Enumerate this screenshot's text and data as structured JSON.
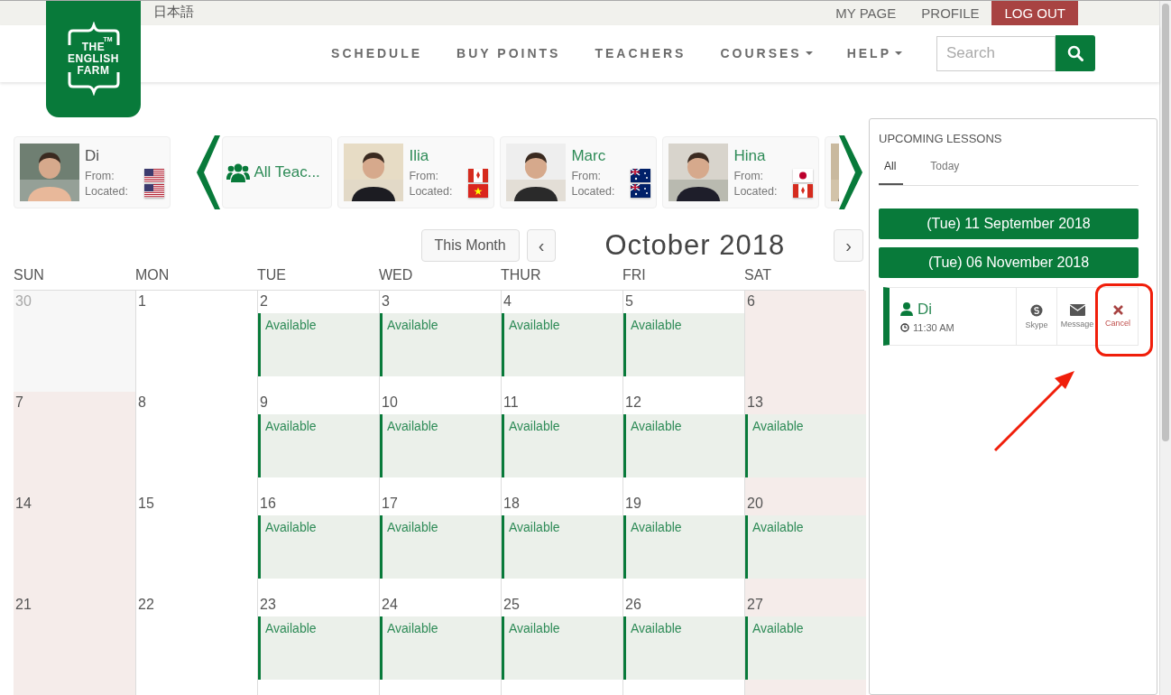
{
  "top_bar": {
    "language": "日本語",
    "links": [
      {
        "label": "MY PAGE",
        "kind": "link"
      },
      {
        "label": "PROFILE",
        "kind": "link"
      },
      {
        "label": "LOG OUT",
        "kind": "danger"
      }
    ]
  },
  "logo": {
    "lines": [
      "THE",
      "ENGLISH",
      "FARM"
    ],
    "mark": "TM"
  },
  "nav": [
    {
      "label": "SCHEDULE",
      "dropdown": false
    },
    {
      "label": "BUY POINTS",
      "dropdown": false
    },
    {
      "label": "TEACHERS",
      "dropdown": false
    },
    {
      "label": "COURSES",
      "dropdown": true
    },
    {
      "label": "HELP",
      "dropdown": true
    }
  ],
  "search": {
    "placeholder": "Search"
  },
  "current_teacher": {
    "name": "Di",
    "photo": {
      "kind": "picture"
    },
    "from": {
      "label": "From:",
      "kind": "us"
    },
    "located": {
      "label": "Located:",
      "kind": "us"
    }
  },
  "carousel": {
    "all_label": "All Teac...",
    "teachers": [
      {
        "name": "Ilia",
        "photo": {
          "kind": "picture"
        },
        "from": {
          "label": "From:",
          "kind": "ca"
        },
        "located": {
          "label": "Located:",
          "kind": "vn"
        }
      },
      {
        "name": "Marc",
        "photo": {
          "kind": "picture"
        },
        "from": {
          "label": "From:",
          "kind": "au"
        },
        "located": {
          "label": "Located:",
          "kind": "au"
        }
      },
      {
        "name": "Hina",
        "photo": {
          "kind": "picture"
        },
        "from": {
          "label": "From:",
          "kind": "jp"
        },
        "located": {
          "label": "Located:",
          "kind": "ca"
        }
      },
      {
        "photo": {
          "kind": "picture"
        }
      }
    ]
  },
  "calendar": {
    "this_month": "This Month",
    "prev": "‹",
    "next": "›",
    "title": "October 2018",
    "weekdays": [
      "SUN",
      "MON",
      "TUE",
      "WED",
      "THUR",
      "FRI",
      "SAT"
    ],
    "weeks": [
      [
        {
          "day": "30",
          "kind": "other"
        },
        {
          "day": "1",
          "kind": "weekday"
        },
        {
          "day": "2",
          "kind": "weekday",
          "slot": "Available"
        },
        {
          "day": "3",
          "kind": "weekday",
          "slot": "Available"
        },
        {
          "day": "4",
          "kind": "weekday",
          "slot": "Available"
        },
        {
          "day": "5",
          "kind": "weekday",
          "slot": "Available"
        },
        {
          "day": "6",
          "kind": "weekend"
        }
      ],
      [
        {
          "day": "7",
          "kind": "weekend"
        },
        {
          "day": "8",
          "kind": "weekday"
        },
        {
          "day": "9",
          "kind": "weekday",
          "slot": "Available"
        },
        {
          "day": "10",
          "kind": "weekday",
          "slot": "Available"
        },
        {
          "day": "11",
          "kind": "weekday",
          "slot": "Available"
        },
        {
          "day": "12",
          "kind": "weekday",
          "slot": "Available"
        },
        {
          "day": "13",
          "kind": "weekend",
          "slot": "Available"
        }
      ],
      [
        {
          "day": "14",
          "kind": "weekend"
        },
        {
          "day": "15",
          "kind": "weekday"
        },
        {
          "day": "16",
          "kind": "weekday",
          "slot": "Available"
        },
        {
          "day": "17",
          "kind": "weekday",
          "slot": "Available"
        },
        {
          "day": "18",
          "kind": "weekday",
          "slot": "Available"
        },
        {
          "day": "19",
          "kind": "weekday",
          "slot": "Available"
        },
        {
          "day": "20",
          "kind": "weekend",
          "slot": "Available"
        }
      ],
      [
        {
          "day": "21",
          "kind": "weekend"
        },
        {
          "day": "22",
          "kind": "weekday"
        },
        {
          "day": "23",
          "kind": "weekday",
          "slot": "Available"
        },
        {
          "day": "24",
          "kind": "weekday",
          "slot": "Available"
        },
        {
          "day": "25",
          "kind": "weekday",
          "slot": "Available"
        },
        {
          "day": "26",
          "kind": "weekday",
          "slot": "Available"
        },
        {
          "day": "27",
          "kind": "weekend",
          "slot": "Available"
        }
      ]
    ]
  },
  "upcoming": {
    "title": "UPCOMING LESSONS",
    "tabs": [
      {
        "label": "All",
        "selected": true
      },
      {
        "label": "Today",
        "selected": false
      }
    ],
    "dates": [
      "(Tue) 11 September 2018",
      "(Tue) 06 November 2018"
    ],
    "lesson": {
      "teacher": "Di",
      "time": "11:30 AM",
      "actions": [
        {
          "label": "Skype",
          "kind": "skype",
          "highlighted": false
        },
        {
          "label": "Message",
          "kind": "message",
          "highlighted": false
        },
        {
          "label": "Cancel",
          "kind": "cancel",
          "highlighted": true
        }
      ]
    }
  }
}
